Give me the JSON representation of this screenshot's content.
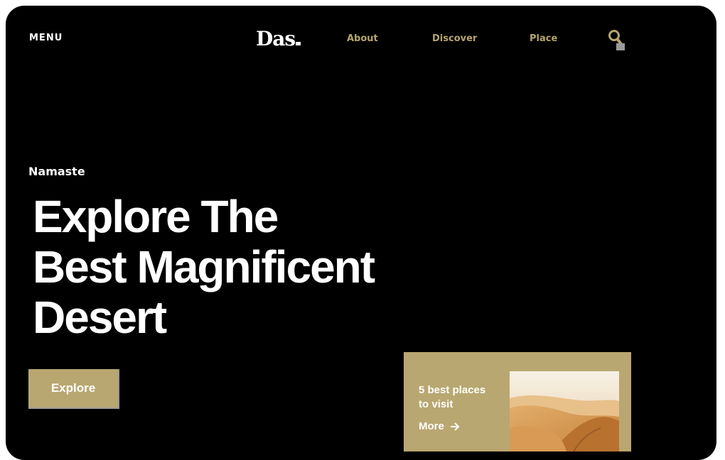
{
  "header": {
    "menu_label": "MENU",
    "logo_text": "Das",
    "nav": [
      {
        "label": "About"
      },
      {
        "label": "Discover"
      },
      {
        "label": "Place"
      }
    ]
  },
  "hero": {
    "tagline": "Namaste",
    "title_lines": [
      "Explore The",
      "Best Magnificent",
      "Desert"
    ],
    "cta_label": "Explore"
  },
  "promo": {
    "text": "5 best places to visit",
    "more_label": "More"
  },
  "colors": {
    "background": "#000000",
    "accent": "#b9a771",
    "text": "#ffffff"
  }
}
